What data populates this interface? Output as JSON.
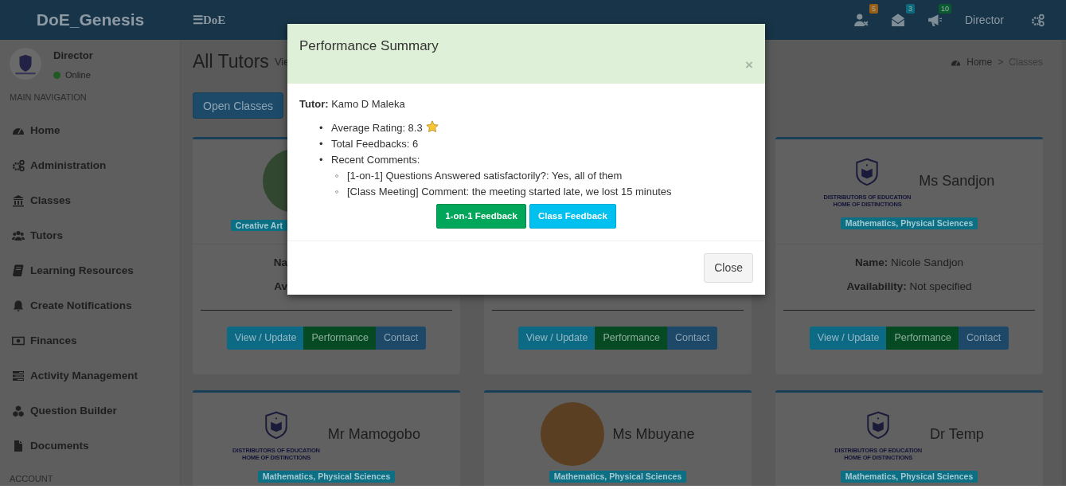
{
  "header": {
    "brand": "DoE_Genesis",
    "toggle_icon": "☰",
    "toggle_label": "DoE",
    "notifications": [
      {
        "kind": "users",
        "count": "5",
        "color": "#9a5f12"
      },
      {
        "kind": "mail",
        "count": "3",
        "color": "#0c6a7c"
      },
      {
        "kind": "alerts",
        "count": "10",
        "color": "#0b5a2d"
      }
    ],
    "user": "Director"
  },
  "sidebar": {
    "user": {
      "name": "Director",
      "status": "Online",
      "online": true
    },
    "section_label": "MAIN NAVIGATION",
    "items": [
      {
        "label": "Home",
        "kind": "dashboard"
      },
      {
        "label": "Administration",
        "kind": "gears"
      },
      {
        "label": "Classes",
        "kind": "bank"
      },
      {
        "label": "Tutors",
        "kind": "users"
      },
      {
        "label": "Learning Resources",
        "kind": "book"
      },
      {
        "label": "Create Notifications",
        "kind": "bell"
      },
      {
        "label": "Finances",
        "kind": "money"
      },
      {
        "label": "Activity Management",
        "kind": "tasks"
      },
      {
        "label": "Question Builder",
        "kind": "cubes"
      },
      {
        "label": "Documents",
        "kind": "file"
      }
    ],
    "footer_label": "ACCOUNT"
  },
  "content": {
    "title": "All Tutors",
    "subtitle": "Vie",
    "breadcrumb": {
      "items": [
        "Home",
        "Classes"
      ],
      "separator": ">"
    },
    "toolbar": [
      "Open Classes"
    ],
    "cards": [
      {
        "kind": "left-visible",
        "avatar": {
          "kind": "photo"
        },
        "badge": "Creative Art",
        "name_line": "**Na**",
        "availability_line": "**Av**",
        "buttons": [
          {
            "label": "View / Update",
            "kind": "view"
          },
          {
            "label": "Performance",
            "kind": "performance"
          },
          {
            "label": "Contact",
            "kind": "contact"
          }
        ]
      },
      {
        "kind": "bottom-visible",
        "buttons": [
          {
            "label": "View / Update",
            "kind": "view"
          },
          {
            "label": "Performance",
            "kind": "performance"
          },
          {
            "label": "Contact",
            "kind": "contact"
          }
        ]
      },
      {
        "kind": "full",
        "avatar": {
          "kind": "logo",
          "caption": [
            "DISTRIBUTORS OF EDUCATION",
            "HOME OF DISTINCTIONS"
          ]
        },
        "title": "Ms Sandjon",
        "badge": "Mathematics, Physical Sciences",
        "name_line": "**Name:** Nicole Sandjon",
        "availability_line": "**Availability:** Not specified",
        "buttons": [
          {
            "label": "View / Update",
            "kind": "view"
          },
          {
            "label": "Performance",
            "kind": "performance"
          },
          {
            "label": "Contact",
            "kind": "contact"
          }
        ]
      },
      {
        "kind": "full",
        "avatar": {
          "kind": "logo",
          "caption": [
            "DISTRIBUTORS OF EDUCATION",
            "HOME OF DISTINCTIONS"
          ]
        },
        "title": "Mr Mamogobo",
        "badge": "Mathematics, Physical Sciences"
      },
      {
        "kind": "full",
        "avatar": {
          "kind": "photo"
        },
        "title": "Ms Mbuyane",
        "badge": "Mathematics, Physical Sciences"
      },
      {
        "kind": "full",
        "avatar": {
          "kind": "logo",
          "caption": [
            "DISTRIBUTORS OF EDUCATION",
            "HOME OF DISTINCTIONS"
          ]
        },
        "title": "Dr Temp",
        "badge": "Mathematics, Physical Sciences"
      }
    ]
  },
  "dialog": {
    "title": "Performance Summary",
    "close_icon": "×",
    "tutor_line": "**Tutor:** Kamo D Maleka",
    "stats": [
      {
        "kind": "rating",
        "marker": "•",
        "text": "Average Rating: 8.3"
      },
      {
        "kind": "plain",
        "marker": "•",
        "text": "Total Feedbacks: 6"
      },
      {
        "kind": "plain",
        "marker": "•",
        "text": "Recent Comments:",
        "children": [
          {
            "marker": "◦",
            "text": "[1-on-1] Questions Answered satisfactorily?: Yes, all of them"
          },
          {
            "marker": "◦",
            "text": "[Class Meeting] Comment: the meeting started late, we lost 15 minutes"
          }
        ]
      }
    ],
    "actions": [
      {
        "label": "1-on-1 Feedback",
        "kind": "success"
      },
      {
        "label": "Class Feedback",
        "kind": "info"
      }
    ],
    "footer_button": "Close"
  }
}
